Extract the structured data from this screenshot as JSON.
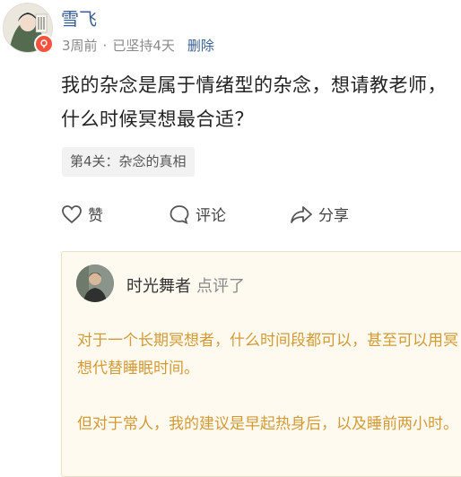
{
  "user": {
    "name": "雪飞",
    "time": "3周前",
    "persistence": "已坚持4天",
    "delete_label": "删除"
  },
  "post": {
    "text": "我的杂念是属于情绪型的杂念，想请教老师，什么时候冥想最合适？",
    "tag": "第4关：杂念的真相"
  },
  "actions": {
    "like": "赞",
    "comment": "评论",
    "share": "分享"
  },
  "review": {
    "reviewer_name": "时光舞者",
    "action": "点评了",
    "paragraphs": [
      "对于一个长期冥想者，什么时间段都可以，甚至可以用冥想代替睡眠时间。",
      "但对于常人，我的建议是早起热身后，以及睡前两小时。"
    ]
  },
  "colors": {
    "link": "#3a5f94",
    "review_text": "#d29a35",
    "review_bg": "#fffaf0",
    "badge": "#f5533d"
  }
}
